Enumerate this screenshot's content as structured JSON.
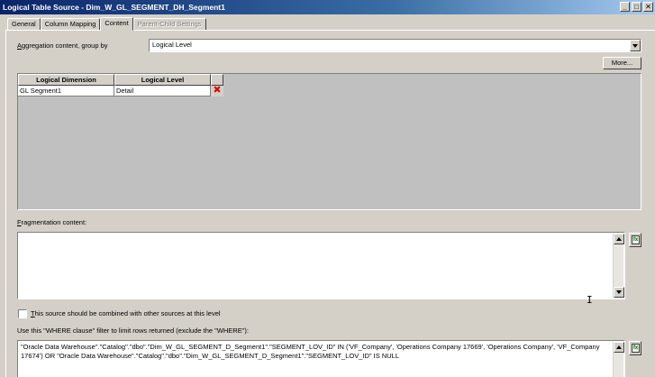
{
  "window": {
    "title": "Logical Table Source - Dim_W_GL_SEGMENT_DH_Segment1",
    "minimize_glyph": "_",
    "maximize_glyph": "□",
    "close_glyph": "✕"
  },
  "tabs": [
    {
      "label": "General",
      "state": "normal"
    },
    {
      "label": "Column Mapping",
      "state": "normal"
    },
    {
      "label": "Content",
      "state": "active"
    },
    {
      "label": "Parent-Child Settings",
      "state": "disabled"
    }
  ],
  "aggregation": {
    "label": "Aggregation content, group by",
    "accel": "A",
    "label_rest": "ggregation content, group by",
    "selected": "Logical Level"
  },
  "more_button": "More...",
  "grid": {
    "columns": [
      "Logical Dimension",
      "Logical Level"
    ],
    "rows": [
      {
        "dimension": "GL Segment1",
        "level": "Detail"
      }
    ],
    "delete_glyph": "✖"
  },
  "fragmentation": {
    "accel": "F",
    "label_rest": "ragmentation content:",
    "value": ""
  },
  "combine_checkbox": {
    "accel": "T",
    "label_rest": "his source should be combined with other sources at this level",
    "checked": false
  },
  "where_clause": {
    "label": "Use this \"WHERE clause\" filter to limit rows returned (exclude the \"WHERE\"):",
    "value": "\"Oracle Data Warehouse\".\"Catalog\".\"dbo\".\"Dim_W_GL_SEGMENT_D_Segment1\".\"SEGMENT_LOV_ID\" IN ('VF_Company', 'Operations Company 17669', 'Operations Company', 'VF_Company 17674') OR \"Oracle Data Warehouse\".\"Catalog\".\"dbo\".\"Dim_W_GL_SEGMENT_D_Segment1\".\"SEGMENT_LOV_ID\" IS NULL"
  },
  "expression_icon": "fx"
}
